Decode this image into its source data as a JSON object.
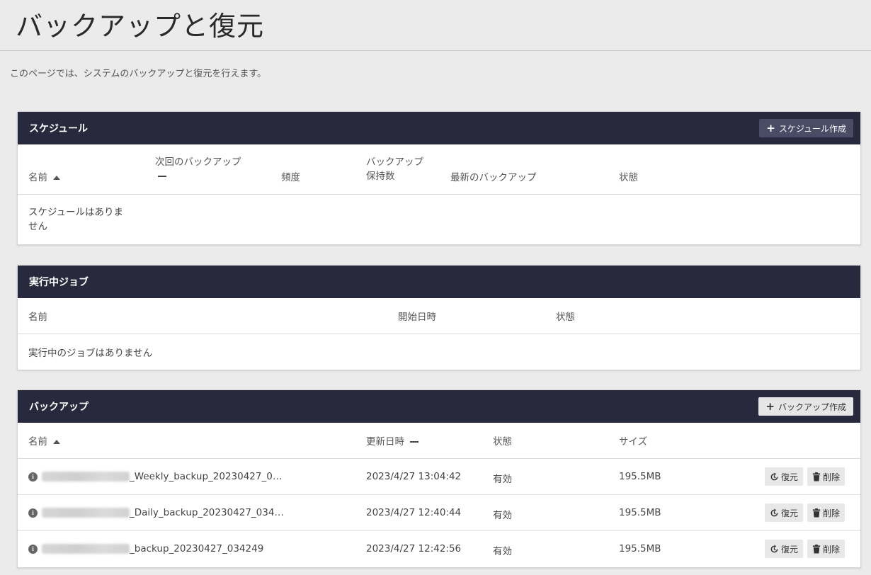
{
  "page": {
    "title": "バックアップと復元",
    "description": "このページでは、システムのバックアップと復元を行えます。"
  },
  "schedule": {
    "title": "スケジュール",
    "create_label": "スケジュール作成",
    "columns": {
      "name": "名前",
      "next_backup_line1": "次回のバックアップ",
      "frequency": "頻度",
      "retention_line1": "バックアップ",
      "retention_line2": "保持数",
      "latest_backup": "最新のバックアップ",
      "status": "状態"
    },
    "empty_line1": "スケジュールはありま",
    "empty_line2": "せん"
  },
  "jobs": {
    "title": "実行中ジョブ",
    "columns": {
      "name": "名前",
      "start": "開始日時",
      "status": "状態"
    },
    "empty": "実行中のジョブはありません"
  },
  "backups": {
    "title": "バックアップ",
    "create_label": "バックアップ作成",
    "columns": {
      "name": "名前",
      "updated": "更新日時",
      "status": "状態",
      "size": "サイズ"
    },
    "restore_label": "復元",
    "delete_label": "削除",
    "rows": [
      {
        "name": "_Weekly_backup_20230427_0…",
        "updated": "2023/4/27 13:04:42",
        "status": "有効",
        "size": "195.5MB"
      },
      {
        "name": "_Daily_backup_20230427_034…",
        "updated": "2023/4/27 12:40:44",
        "status": "有効",
        "size": "195.5MB"
      },
      {
        "name": "_backup_20230427_034249",
        "updated": "2023/4/27 12:42:56",
        "status": "有効",
        "size": "195.5MB"
      }
    ]
  }
}
